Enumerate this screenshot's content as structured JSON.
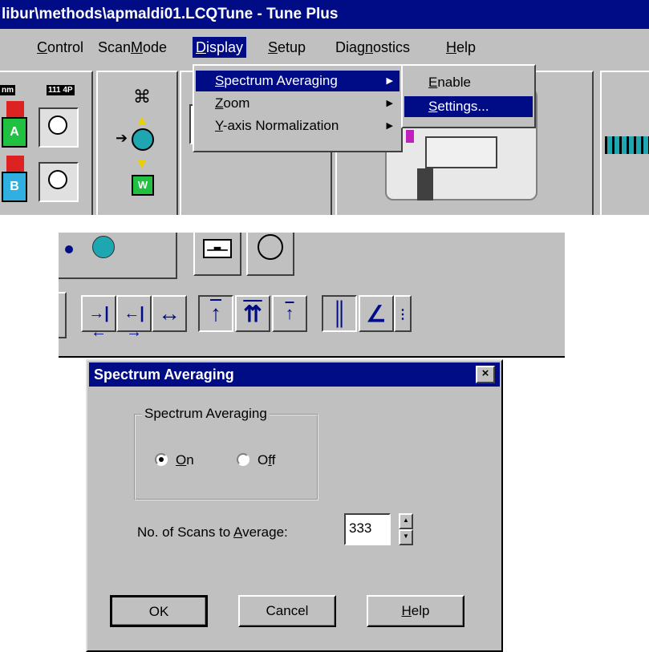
{
  "window": {
    "title": "libur\\methods\\apmaldi01.LCQTune - Tune Plus"
  },
  "menubar": {
    "items": [
      {
        "label": "Control",
        "ul": "C",
        "rest": "ontrol"
      },
      {
        "label": "ScanMode",
        "pre": "Scan",
        "ul": "M",
        "rest": "ode"
      },
      {
        "label": "Display",
        "ul": "D",
        "rest": "isplay"
      },
      {
        "label": "Setup",
        "ul": "S",
        "rest": "etup"
      },
      {
        "label": "Diagnostics",
        "pre": "Diag",
        "ul": "n",
        "rest": "ostics"
      },
      {
        "label": "Help",
        "ul": "H",
        "rest": "elp"
      }
    ]
  },
  "display_menu": {
    "items": [
      {
        "ul": "S",
        "rest": "pectrum Averaging"
      },
      {
        "ul": "Z",
        "rest": "oom"
      },
      {
        "ul": "Y",
        "rest": "-axis Normalization"
      }
    ]
  },
  "averaging_submenu": {
    "items": [
      {
        "ul": "E",
        "rest": "nable"
      },
      {
        "ul": "S",
        "rest": "ettings..."
      }
    ]
  },
  "toolbar": {
    "badge_left": "nm",
    "badge_right": "111 4P",
    "pump_a": "A",
    "pump_b": "B",
    "waste": "W"
  },
  "dialog": {
    "title": "Spectrum Averaging",
    "close": "×",
    "group_label": "Spectrum Averaging",
    "radio_on": {
      "ul": "O",
      "rest": "n",
      "checked": true
    },
    "radio_off": {
      "pre": "O",
      "ul": "f",
      "rest": "f",
      "checked": false
    },
    "scans_label_pre": "No. of Scans to ",
    "scans_label_ul": "A",
    "scans_label_rest": "verage:",
    "scans_value": "333",
    "ok_label": "OK",
    "cancel_label": "Cancel",
    "help_ul": "H",
    "help_rest": "elp"
  },
  "colors": {
    "titlebar": "#000b86",
    "face": "#c0c0c0",
    "accent": "#1ea7b0"
  }
}
